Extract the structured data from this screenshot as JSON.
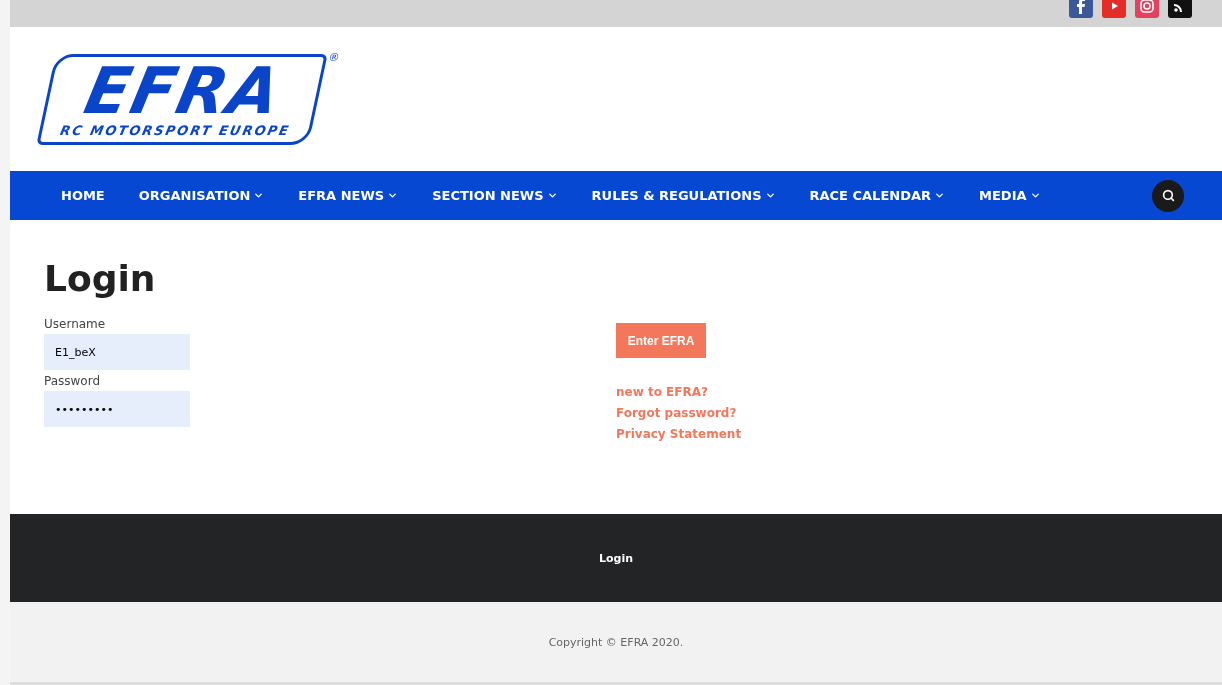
{
  "social": [
    {
      "kind": "facebook",
      "color": "#3b5998"
    },
    {
      "kind": "youtube",
      "color": "#e52d27"
    },
    {
      "kind": "instagram",
      "color": "#e4405f"
    },
    {
      "kind": "rss",
      "color": "#111111"
    }
  ],
  "logo": {
    "name": "EFRA",
    "tagline": "RC MOTORSPORT EUROPE",
    "mark": "®"
  },
  "nav": [
    {
      "label": "HOME",
      "dropdown": false
    },
    {
      "label": "ORGANISATION",
      "dropdown": true
    },
    {
      "label": "EFRA NEWS",
      "dropdown": true
    },
    {
      "label": "SECTION NEWS",
      "dropdown": true
    },
    {
      "label": "RULES & REGULATIONS",
      "dropdown": true
    },
    {
      "label": "RACE CALENDAR",
      "dropdown": true
    },
    {
      "label": "MEDIA",
      "dropdown": true
    }
  ],
  "title": "Login",
  "form": {
    "fields": [
      {
        "label": "Username",
        "value": "E1_beX"
      },
      {
        "label": "Password",
        "value": "•••••••••"
      }
    ],
    "button": "Enter EFRA",
    "links": [
      "new to EFRA?",
      "Forgot password?",
      "Privacy Statement"
    ]
  },
  "footer": {
    "link": "Login",
    "copyright": "Copyright © EFRA 2020."
  }
}
